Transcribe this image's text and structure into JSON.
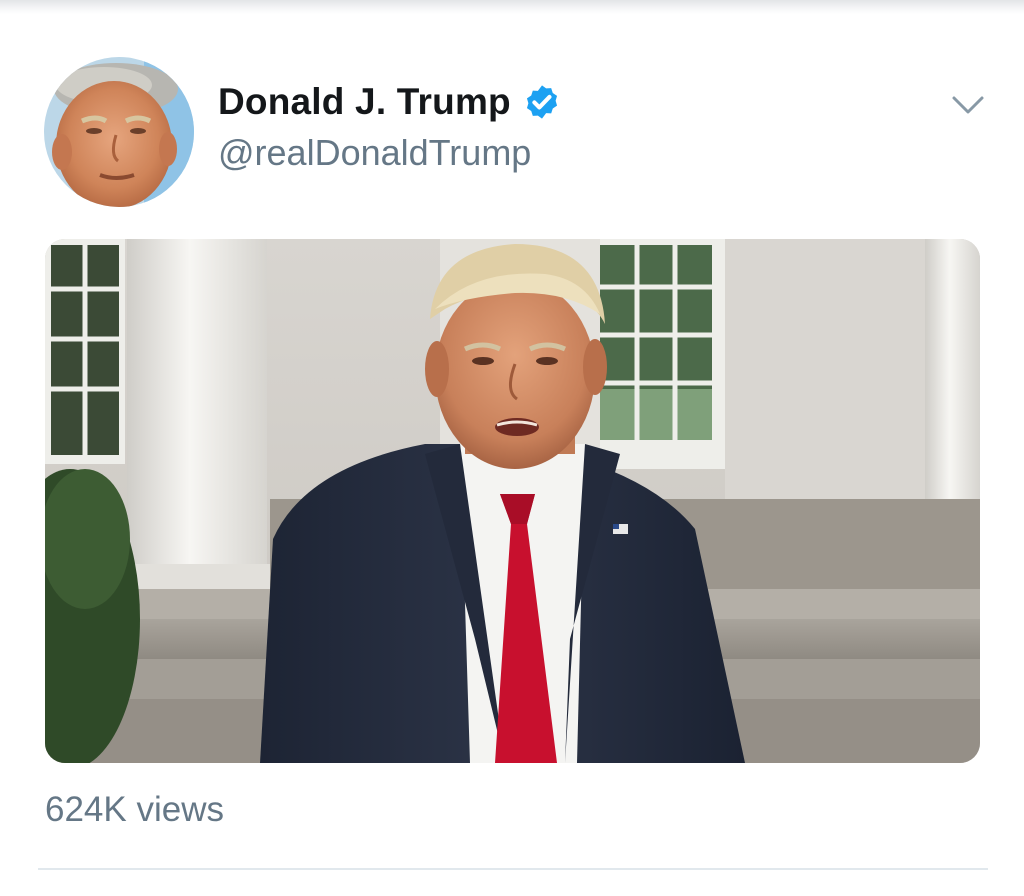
{
  "tweet": {
    "author": {
      "display_name": "Donald J. Trump",
      "handle": "@realDonaldTrump",
      "verified": true,
      "verified_icon": "verified-badge-icon",
      "avatar_icon": "avatar"
    },
    "menu_icon": "chevron-down-icon",
    "media": {
      "type": "video",
      "view_count_label": "624K views"
    }
  },
  "colors": {
    "name_text": "#14171a",
    "secondary_text": "#657786",
    "verified_blue": "#1da1f2",
    "divider": "#e1e8ed"
  }
}
